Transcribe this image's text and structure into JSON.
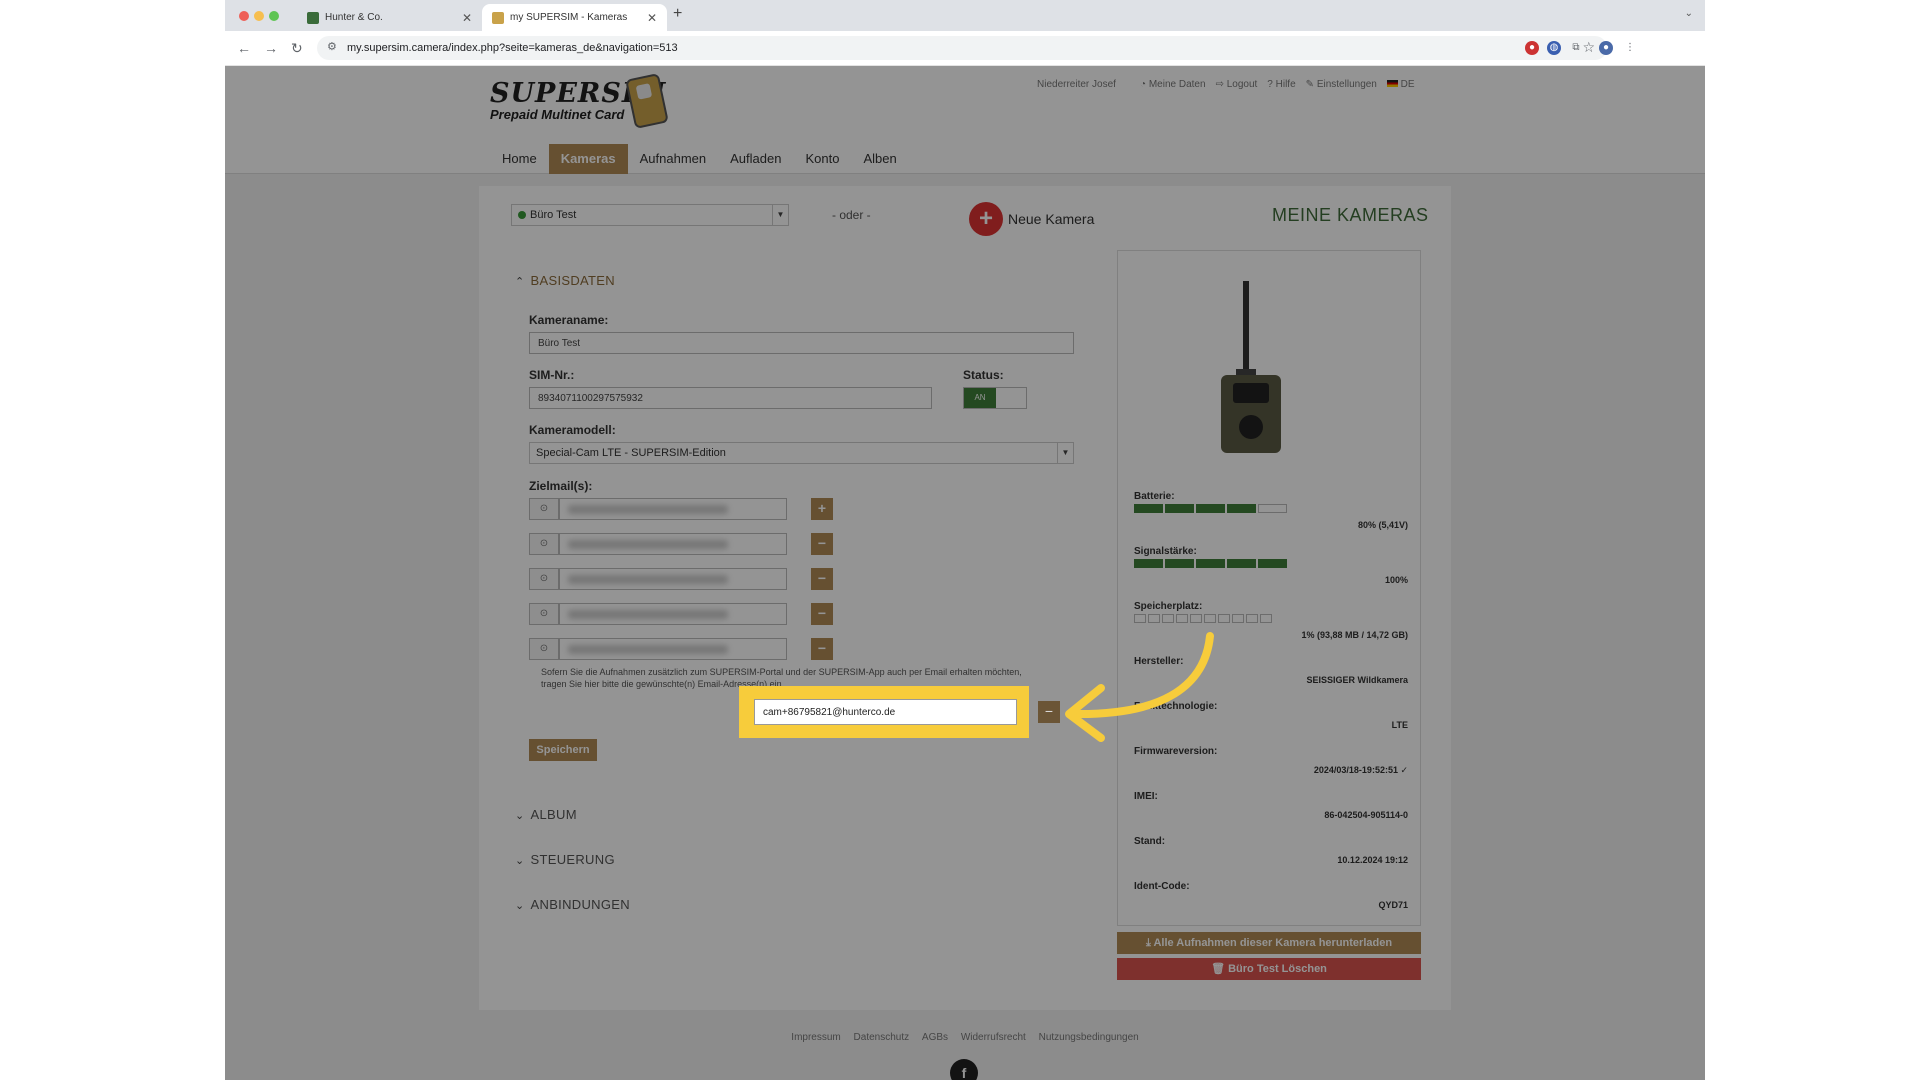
{
  "browser": {
    "tabs": [
      {
        "title": "Hunter & Co.",
        "active": false
      },
      {
        "title": "my SUPERSIM - Kameras",
        "active": true
      }
    ],
    "url": "my.supersim.camera/index.php?seite=kameras_de&navigation=513"
  },
  "header": {
    "logo_line1": "SUPERSIM",
    "logo_line2": "Prepaid Multinet Card",
    "user": "Niederreiter Josef",
    "links": [
      "Meine Daten",
      "Logout",
      "Hilfe",
      "Einstellungen",
      "DE"
    ],
    "nav": [
      "Home",
      "Kameras",
      "Aufnahmen",
      "Aufladen",
      "Konto",
      "Alben"
    ],
    "active_nav": "Kameras"
  },
  "camera_bar": {
    "selected_camera": "Büro Test",
    "or_text": "- oder -",
    "new_camera": "Neue Kamera",
    "title": "MEINE KAMERAS"
  },
  "basisdaten": {
    "section": "BASISDATEN",
    "name_label": "Kameraname:",
    "name_value": "Büro Test",
    "sim_label": "SIM-Nr.:",
    "sim_value": "8934071100297575932",
    "status_label": "Status:",
    "status_value": "AN",
    "model_label": "Kameramodell:",
    "model_value": "Special-Cam LTE - SUPERSIM-Edition",
    "mail_label": "Zielmail(s):",
    "hint_text": "Sofern Sie die Aufnahmen zusätzlich zum SUPERSIM-Portal und der SUPERSIM-App auch per Email erhalten möchten,",
    "hint_text2": "tragen Sie hier bitte die gewünschte(n) Email-Adresse(n) ein.",
    "new_mail_value": "cam+86795821@hunterco.de",
    "save_button": "Speichern"
  },
  "sections": [
    "ALBUM",
    "STEUERUNG",
    "ANBINDUNGEN"
  ],
  "stats": {
    "battery_label": "Batterie:",
    "battery_value": "80% (5,41V)",
    "battery_level": 0.8,
    "signal_label": "Signalstärke:",
    "signal_value": "100%",
    "signal_level": 1.0,
    "storage_label": "Speicherplatz:",
    "storage_value": "1% (93,88 MB / 14,72 GB)",
    "storage_level": 0.01,
    "maker_label": "Hersteller:",
    "maker_value": "SEISSIGER Wildkamera",
    "tech_label": "Funktechnologie:",
    "tech_value": "LTE",
    "fw_label": "Firmwareversion:",
    "fw_value": "2024/03/18-19:52:51 ✓",
    "imei_label": "IMEI:",
    "imei_value": "86-042504-905114-0",
    "stand_label": "Stand:",
    "stand_value": "10.12.2024 19:12",
    "ident_label": "Ident-Code:",
    "ident_value": "QYD71"
  },
  "actions": {
    "download_all": "⤓ Alle Aufnahmen dieser Kamera herunterladen",
    "delete": "🗑 Büro Test Löschen"
  },
  "footer": [
    "Impressum",
    "Datenschutz",
    "AGBs",
    "Widerrufsrecht",
    "Nutzungsbedingungen"
  ],
  "footer_social": "f",
  "colors": {
    "accent": "#b08a55",
    "status_green": "#3f7f3a",
    "delete_red": "#d9534f",
    "highlight": "#f7cc3b"
  }
}
